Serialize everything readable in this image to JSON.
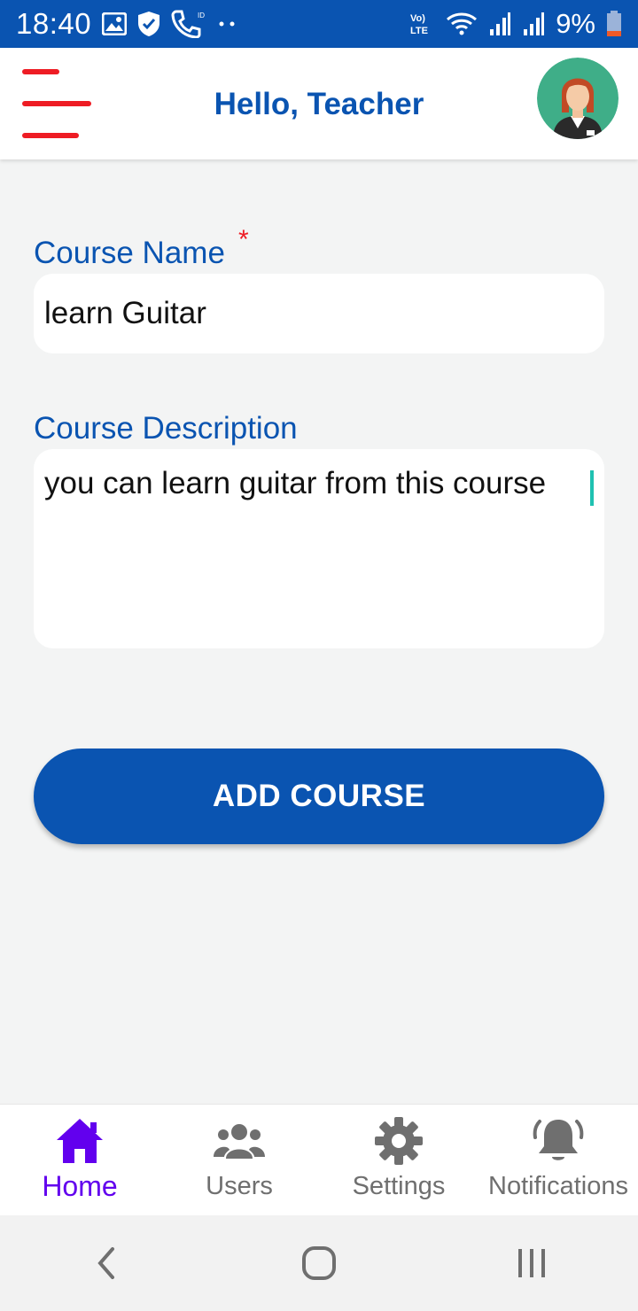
{
  "status_bar": {
    "time": "18:40",
    "battery": "9%",
    "left_icons": [
      "image-icon",
      "shield-icon",
      "phone-icon"
    ],
    "right_icons": [
      "volte-icon",
      "wifi-icon",
      "signal-icon",
      "signal-icon",
      "battery-low-icon"
    ]
  },
  "header": {
    "title": "Hello, Teacher",
    "menu_color": "#ee1c24"
  },
  "form": {
    "course_name": {
      "label": "Course Name",
      "required_mark": "*",
      "value": "learn Guitar"
    },
    "course_description": {
      "label": "Course Description",
      "value": "you can learn guitar from this course"
    },
    "submit_label": "ADD COURSE"
  },
  "bottom_nav": {
    "items": [
      {
        "label": "Home",
        "icon": "home-icon",
        "active": true
      },
      {
        "label": "Users",
        "icon": "users-icon",
        "active": false
      },
      {
        "label": "Settings",
        "icon": "gear-icon",
        "active": false
      },
      {
        "label": "Notifications",
        "icon": "bell-icon",
        "active": false
      }
    ]
  },
  "colors": {
    "primary": "#0a54b1",
    "active_nav": "#6200ee",
    "inactive_nav": "#6f6f6f",
    "required": "#ee1c24",
    "caret": "#1fc1b1",
    "background": "#f3f4f4"
  }
}
